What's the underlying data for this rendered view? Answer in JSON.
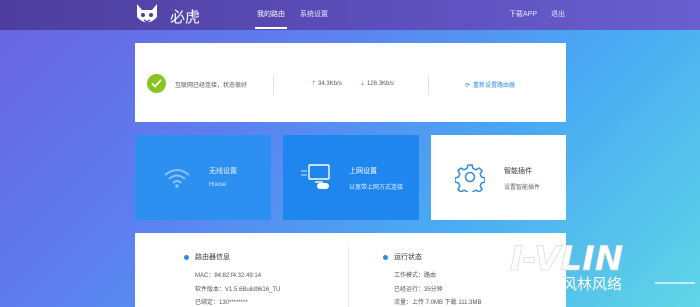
{
  "header": {
    "brand": "必虎",
    "nav": {
      "my_router": "我的路由",
      "system_settings": "系统设置"
    },
    "right": {
      "download_app": "下载APP",
      "logout": "退出"
    }
  },
  "status": {
    "text": "互联网已经连接，状态很好",
    "upload_speed": "34.3Kb/s",
    "download_speed": "126.3Kb/s",
    "reset_label": "重新设置路由器"
  },
  "tiles": {
    "wireless": {
      "title": "无线设置",
      "subtitle": "House"
    },
    "internet": {
      "title": "上网设置",
      "subtitle": "以宽带上网方式连接"
    },
    "plugins": {
      "title": "智能插件",
      "subtitle": "设置智能插件"
    }
  },
  "router_info": {
    "title": "路由器信息",
    "mac": "MAC：84:82:f4:32:49:14",
    "firmware": "软件版本：V1.5.6Build9616_TU",
    "bound": "已绑定：130********"
  },
  "run_status": {
    "title": "运行状态",
    "mode": "工作模式：路由",
    "uptime": "已经运行：35分钟",
    "traffic": "流量：上传 7.0MB 下载 111.3MB"
  },
  "watermark": {
    "logo_text": "I-VLIN",
    "subtitle": "风林风络"
  },
  "colors": {
    "header_bg": "#4e3e9c",
    "accent_blue": "#2f8be6",
    "success_green": "#8ac41f",
    "tile_blue": "#2d8fef"
  }
}
